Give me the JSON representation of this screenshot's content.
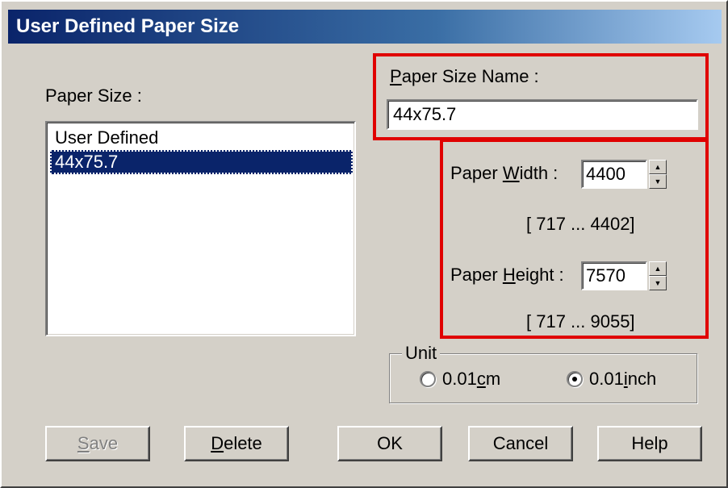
{
  "window": {
    "title": "User Defined Paper Size"
  },
  "paper_size": {
    "label_pre": "",
    "label_key": "",
    "label_text": "Paper Size :",
    "items": [
      "User Defined",
      "44x75.7"
    ],
    "selected_index": 1
  },
  "paper_size_name": {
    "label_key": "P",
    "label_rest": "aper Size Name :",
    "value": "44x75.7"
  },
  "paper_width": {
    "label_pre": "Paper ",
    "label_key": "W",
    "label_post": "idth  :",
    "value": "4400",
    "range": "[  717 ...  4402]"
  },
  "paper_height": {
    "label_pre": "Paper ",
    "label_key": "H",
    "label_post": "eight :",
    "value": "7570",
    "range": "[  717 ...  9055]"
  },
  "unit": {
    "legend": "Unit",
    "cm": {
      "pre": "0.01",
      "key": "c",
      "post": "m"
    },
    "inch": {
      "pre": "0.01",
      "key": "i",
      "post": "nch"
    },
    "selected": "inch"
  },
  "buttons": {
    "save": {
      "key": "S",
      "rest": "ave"
    },
    "delete": {
      "key": "D",
      "rest": "elete"
    },
    "ok": "OK",
    "cancel": "Cancel",
    "help": "Help"
  },
  "colors": {
    "highlight_border": "#e00000",
    "selection": "#0a246a",
    "face": "#d4d0c8"
  }
}
